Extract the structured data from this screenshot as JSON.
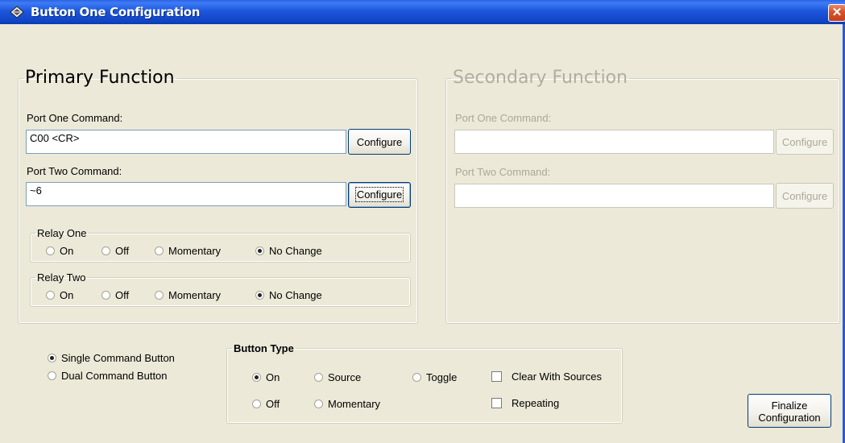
{
  "window": {
    "title": "Button One Configuration",
    "close_glyph": "✕"
  },
  "primary": {
    "legend": "Primary Function",
    "port_one_label": "Port One Command:",
    "port_one_value": "C00 <CR>",
    "port_one_button": "Configure",
    "port_two_label": "Port Two Command:",
    "port_two_value": "~6",
    "port_two_button": "Configure",
    "relay_one": {
      "legend": "Relay One",
      "options": [
        "On",
        "Off",
        "Momentary",
        "No Change"
      ],
      "selected": "No Change"
    },
    "relay_two": {
      "legend": "Relay Two",
      "options": [
        "On",
        "Off",
        "Momentary",
        "No Change"
      ],
      "selected": "No Change"
    }
  },
  "secondary": {
    "legend": "Secondary Function",
    "port_one_label": "Port One Command:",
    "port_one_value": "",
    "port_one_button": "Configure",
    "port_two_label": "Port Two Command:",
    "port_two_value": "",
    "port_two_button": "Configure"
  },
  "command_mode": {
    "options": [
      "Single Command Button",
      "Dual Command Button"
    ],
    "selected": "Single Command Button"
  },
  "button_type": {
    "legend": "Button Type",
    "radio_options": [
      "On",
      "Source",
      "Toggle",
      "Off",
      "Momentary"
    ],
    "selected": "On",
    "checkboxes": [
      {
        "label": "Clear With Sources",
        "checked": false
      },
      {
        "label": "Repeating",
        "checked": false
      }
    ]
  },
  "finalize": {
    "line1": "Finalize",
    "line2": "Configuration"
  },
  "colors": {
    "titlebar": "#1d56dd",
    "dialog_bg": "#ece9d8",
    "close_button": "#d8512a",
    "disabled_text": "#aca899"
  }
}
